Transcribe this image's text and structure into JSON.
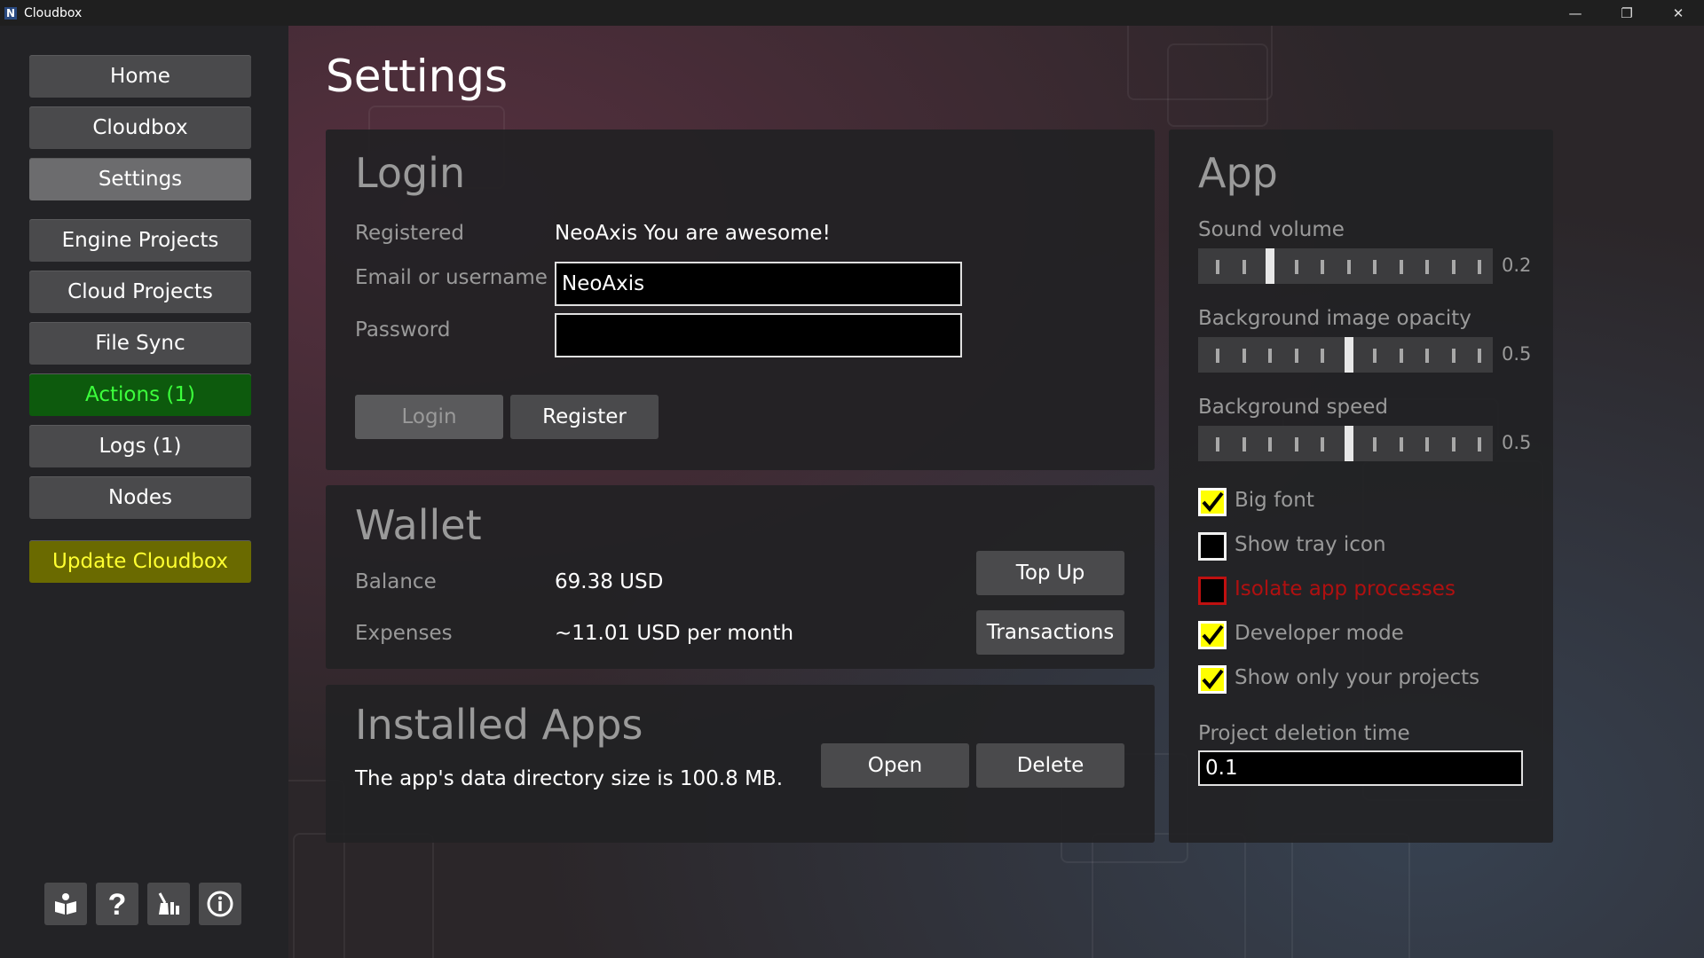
{
  "window": {
    "title": "Cloudbox",
    "logo_letter": "N",
    "minimize": "—",
    "restore": "❐",
    "close": "✕"
  },
  "sidebar": {
    "items": [
      {
        "label": "Home"
      },
      {
        "label": "Cloudbox"
      },
      {
        "label": "Settings"
      },
      {
        "label": "Engine Projects"
      },
      {
        "label": "Cloud Projects"
      },
      {
        "label": "File Sync"
      },
      {
        "label": "Actions (1)"
      },
      {
        "label": "Logs (1)"
      },
      {
        "label": "Nodes"
      },
      {
        "label": "Update Cloudbox"
      }
    ],
    "active": "Settings",
    "bottom_icons": [
      "book-icon",
      "help-icon",
      "cleanup-icon",
      "info-icon"
    ]
  },
  "page": {
    "title": "Settings"
  },
  "login": {
    "title": "Login",
    "registered_label": "Registered",
    "registered_value": "NeoAxis You are awesome!",
    "email_label": "Email or username",
    "email_value": "NeoAxis",
    "password_label": "Password",
    "password_value": "",
    "login_button": "Login",
    "register_button": "Register"
  },
  "wallet": {
    "title": "Wallet",
    "balance_label": "Balance",
    "balance_value": "69.38 USD",
    "expenses_label": "Expenses",
    "expenses_value": "~11.01 USD per month",
    "topup_button": "Top Up",
    "transactions_button": "Transactions"
  },
  "installed": {
    "title": "Installed Apps",
    "text": "The app's data directory size is 100.8 MB.",
    "open_button": "Open",
    "delete_button": "Delete"
  },
  "app": {
    "title": "App",
    "sliders": [
      {
        "label": "Sound volume",
        "value": "0.2",
        "level": 0.2
      },
      {
        "label": "Background image opacity",
        "value": "0.5",
        "level": 0.5
      },
      {
        "label": "Background speed",
        "value": "0.5",
        "level": 0.5
      }
    ],
    "checkboxes": [
      {
        "label": "Big font",
        "checked": true
      },
      {
        "label": "Show tray icon",
        "checked": false
      },
      {
        "label": "Isolate app processes",
        "checked": false,
        "warning": true
      },
      {
        "label": "Developer mode",
        "checked": true
      },
      {
        "label": "Show only your projects",
        "checked": true
      }
    ],
    "deletion_label": "Project deletion time",
    "deletion_value": "0.1"
  },
  "colors": {
    "accent_green": "#3cff3c",
    "accent_yellow": "#ffff30",
    "check_yellow": "#ffff00",
    "warning_red": "#b01010"
  }
}
